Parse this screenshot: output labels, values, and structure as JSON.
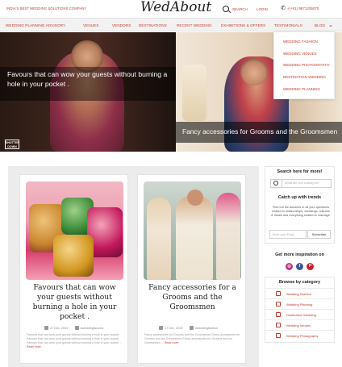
{
  "header": {
    "tagline": "INDIA'S BEST WEDDING SOLUTIONS COMPANY",
    "logo": "WedAbout",
    "search_label": "SEARCH",
    "login_label": "LOGIN",
    "phone": "+(+91) 9871205070"
  },
  "nav": {
    "items": [
      "WEDDING PLANNING ADVISORY",
      "VENUES",
      "VENDORS",
      "DESTINATIONS",
      "RECENT WEDDING",
      "EXHIBITIONS & OFFERS",
      "TESTIMONIALS",
      "BLOG"
    ]
  },
  "blog_menu": {
    "items": [
      "WEDDING FASHION",
      "WEDDING VENUES",
      "WEDDING PHOTOGRAPHY",
      "DESTINATION WEDDING",
      "WEDDING PLANNING"
    ]
  },
  "hero": {
    "left_caption": "Favours that can wow your guests without burning a hole in your pocket .",
    "right_caption": "Fancy accessories for Grooms and the Groomsmen",
    "watermark": "SHUTTER DOWN"
  },
  "posts": [
    {
      "title": "Favours that can wow your guests without burning a hole in your pocket .",
      "date": "27 Dec, 2019",
      "tag": "#weddingfavours",
      "excerpt": "Favours that can wow your guests without burning a hole in your pocket Favours that can wow your guests without burning a hole in your pocket Favours that can wow your guests without burning a hole in your pocket ...",
      "readmore": "Read more"
    },
    {
      "title": "Fancy accessories for a Grooms and the Groomsmen",
      "date": "17 Dec, 2019",
      "tag": "#weddingfashion",
      "excerpt": "Fancy accessories for Grooms and the Groomsmen Fancy accessories for Grooms and the Groomsmen Fancy accessories for Grooms and the Groomsmen ...",
      "readmore": "Read more"
    }
  ],
  "sidebar": {
    "search_heading": "Search here for more!",
    "search_placeholder": "What are you looking for?",
    "trends_heading": "Catch up with trends",
    "trends_text": "Find out the answers to all your questions related to relationships, weddings, cultures & rituals and everything related to marriage.",
    "email_placeholder": "Enter your Email",
    "subscribe_label": "Subscribe",
    "inspiration_heading": "Get more inspiration on",
    "social": [
      "instagram",
      "facebook",
      "pinterest"
    ],
    "social_colors": [
      "#c13584",
      "#3b5998",
      "#cb2027"
    ],
    "category_heading": "Browse by category",
    "categories": [
      "Wedding Fashion",
      "Wedding Planning",
      "Destination Wedding",
      "Wedding Venues",
      "Wedding Photography"
    ]
  },
  "colors": {
    "accent": "#c0392b",
    "nav_bg": "#f2f2f2",
    "content_bg": "#ececec"
  }
}
